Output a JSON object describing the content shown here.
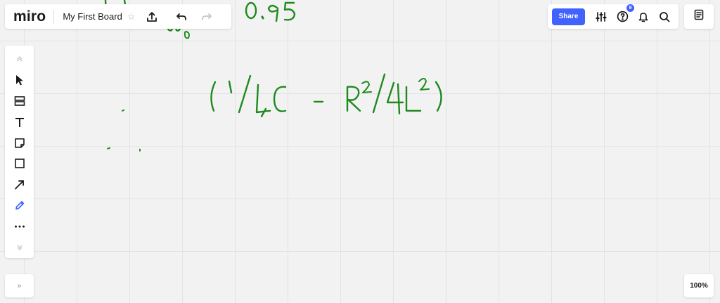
{
  "app": {
    "logo": "miro",
    "board_title": "My First Board"
  },
  "header": {
    "share_label": "Share",
    "notification_count": "9"
  },
  "toolbar": {
    "tools": [
      "collapse-up",
      "select",
      "frame",
      "text",
      "sticky-note",
      "shape",
      "arrow",
      "pen",
      "more",
      "collapse-down"
    ],
    "active_tool": "pen",
    "active_color": "#4262ff"
  },
  "footer": {
    "expand_label": "»",
    "zoom_level": "100%"
  },
  "canvas": {
    "ink_color": "#1e8a1e",
    "handwriting": [
      "0.95",
      "(1/LC - R²/4L²)"
    ]
  }
}
